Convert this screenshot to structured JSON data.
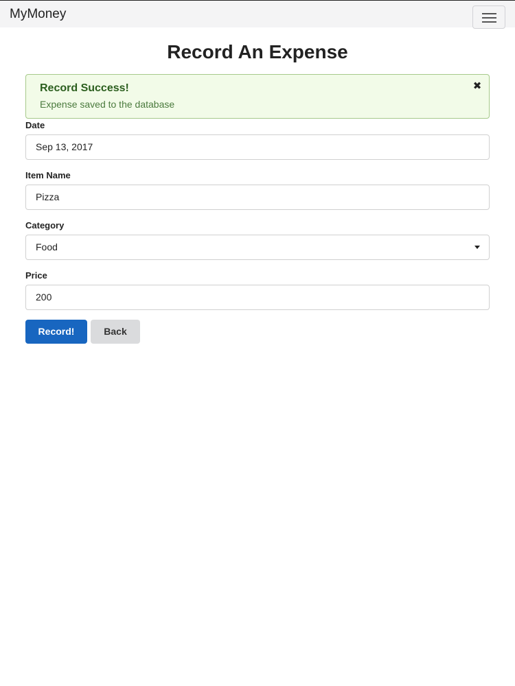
{
  "navbar": {
    "brand": "MyMoney",
    "menu_icon": "hamburger-menu-icon"
  },
  "page": {
    "title": "Record An Expense"
  },
  "alert": {
    "title": "Record Success!",
    "message": "Expense saved to the database",
    "close_icon": "close-icon",
    "close_glyph": "✖"
  },
  "form": {
    "date": {
      "label": "Date",
      "value": "Sep 13, 2017"
    },
    "item_name": {
      "label": "Item Name",
      "value": "Pizza"
    },
    "category": {
      "label": "Category",
      "value": "Food",
      "caret_icon": "caret-down-icon"
    },
    "price": {
      "label": "Price",
      "value": "200"
    }
  },
  "actions": {
    "record_label": "Record!",
    "back_label": "Back"
  },
  "colors": {
    "primary": "#1866c0",
    "alert_background": "#f2fbe8",
    "alert_border": "#a6c98a",
    "alert_title": "#2b5e1e",
    "secondary_button": "#dadbdd",
    "navbar_background": "#f4f4f5"
  }
}
